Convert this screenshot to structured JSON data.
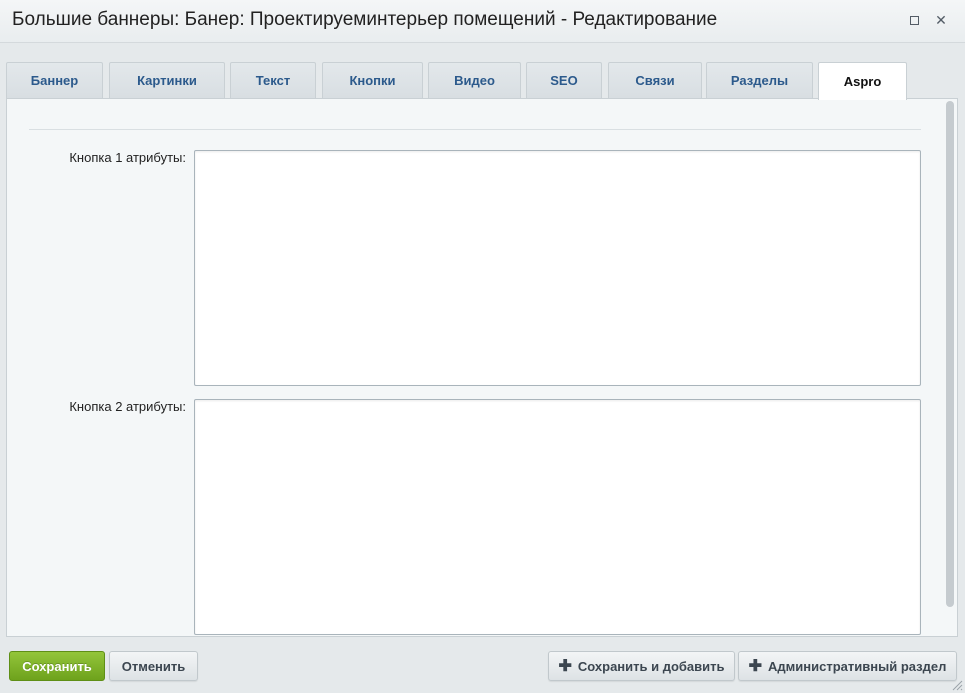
{
  "window": {
    "title": "Большие баннеры: Банер: Проектируеминтерьер помещений - Редактирование",
    "maximize_icon": "maximize-icon",
    "close_icon": "close-icon",
    "close_glyph": "✕"
  },
  "tabs": [
    {
      "label": "Баннер",
      "active": false
    },
    {
      "label": "Картинки",
      "active": false
    },
    {
      "label": "Текст",
      "active": false
    },
    {
      "label": "Кнопки",
      "active": false
    },
    {
      "label": "Видео",
      "active": false
    },
    {
      "label": "SEO",
      "active": false
    },
    {
      "label": "Связи",
      "active": false
    },
    {
      "label": "Разделы",
      "active": false
    },
    {
      "label": "Aspro",
      "active": true
    }
  ],
  "form": {
    "button1_attrs": {
      "label": "Кнопка 1 атрибуты:",
      "value": ""
    },
    "button2_attrs": {
      "label": "Кнопка 2 атрибуты:",
      "value": ""
    }
  },
  "footer": {
    "save_label": "Сохранить",
    "cancel_label": "Отменить",
    "save_add_label": "Сохранить и добавить",
    "admin_label": "Административный раздел",
    "plus_glyph": "✚"
  },
  "colors": {
    "accent_green": "#7ab02a",
    "tab_link": "#2c5a8c"
  }
}
